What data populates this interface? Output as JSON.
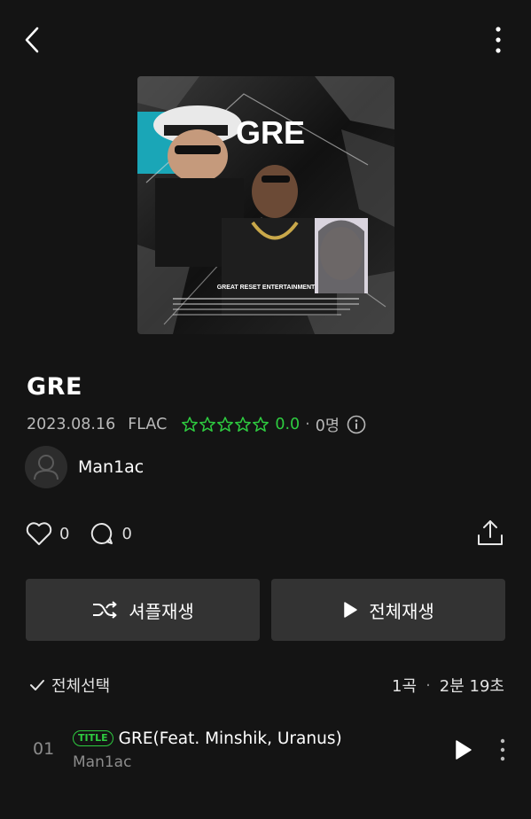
{
  "header": {
    "back_icon": "chevron-left-icon",
    "more_icon": "vertical-ellipsis-icon"
  },
  "album": {
    "cover_title_text": "GRE",
    "cover_label_text": "GREAT RESET ENTERTAINMENT",
    "title": "GRE",
    "date": "2023.08.16",
    "format": "FLAC",
    "star_count": 5,
    "rating": "0.0",
    "dot": "·",
    "rater_count": "0명"
  },
  "artist": {
    "name": "Man1ac"
  },
  "social": {
    "like_count": "0",
    "comment_count": "0"
  },
  "buttons": {
    "shuffle_label": "셔플재생",
    "play_all_label": "전체재생"
  },
  "tracklist": {
    "select_all_label": "전체선택",
    "song_count": "1곡",
    "separator": "·",
    "total_duration": "2분 19초",
    "tracks": [
      {
        "number": "01",
        "badge": "TITLE",
        "title": "GRE(Feat. Minshik, Uranus)",
        "artist": "Man1ac"
      }
    ]
  },
  "colors": {
    "background": "#141414",
    "accent_green": "#2ecc40",
    "button_bg": "#333333",
    "muted_text": "#8c8c8c"
  }
}
